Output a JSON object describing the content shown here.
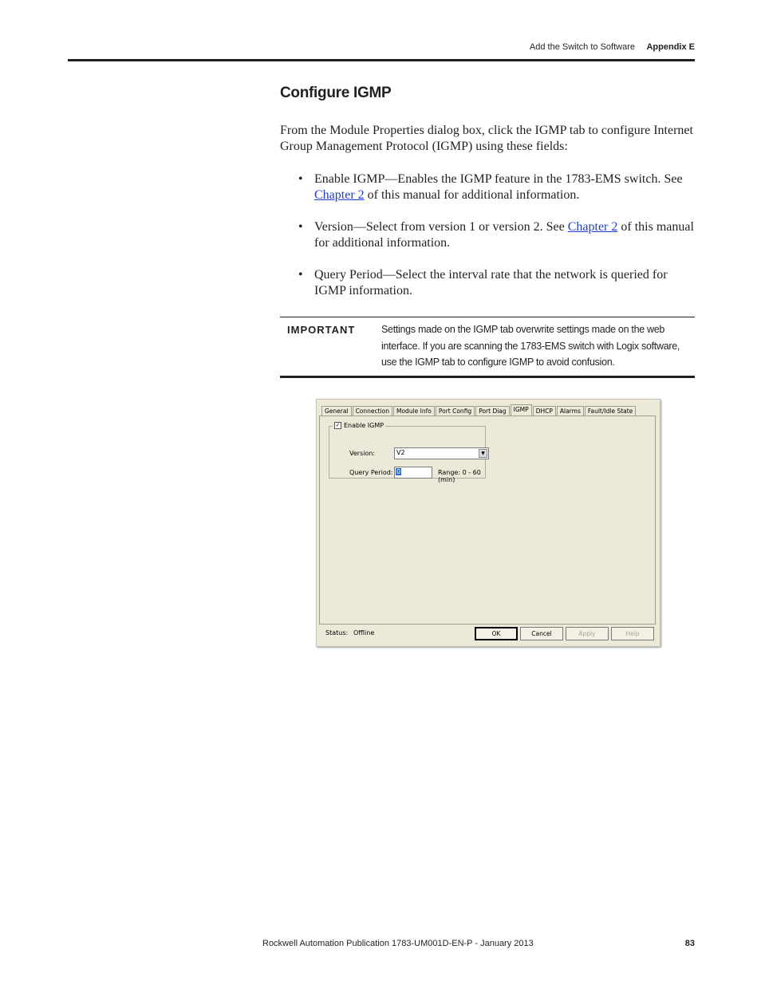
{
  "header": {
    "section": "Add the Switch to Software",
    "appendix": "Appendix E"
  },
  "title": "Configure IGMP",
  "intro": "From the Module Properties dialog box, click the IGMP tab to configure Internet Group Management Protocol (IGMP) using these fields:",
  "bullets": [
    {
      "text1": "Enable IGMP—Enables the IGMP feature in the 1783-EMS switch. See ",
      "link": "Chapter 2",
      "text2": " of this manual for additional information."
    },
    {
      "text1": "Version—Select from version 1 or version 2. See ",
      "link": "Chapter 2",
      "text2": " of this manual for additional information."
    },
    {
      "text1": "Query Period—Select the interval rate that the network is queried for IGMP information.",
      "link": "",
      "text2": ""
    }
  ],
  "important": {
    "label": "IMPORTANT",
    "text": "Settings made on the IGMP tab overwrite settings made on the web interface. If you are scanning the 1783-EMS switch with Logix software, use the IGMP tab to configure IGMP to avoid confusion."
  },
  "dialog": {
    "tabs": [
      "General",
      "Connection",
      "Module Info",
      "Port Config",
      "Port Diag",
      "IGMP",
      "DHCP",
      "Alarms",
      "Fault/Idle State"
    ],
    "enable_igmp_label": "Enable IGMP",
    "enable_igmp_checked": true,
    "check_mark": "✓",
    "version_label": "Version:",
    "version_value": "V2",
    "dropdown_glyph": "▼",
    "query_period_label": "Query Period:",
    "query_period_value": "0",
    "range_text": "Range: 0 - 60 (min)",
    "status_label": "Status:",
    "status_value": "Offline",
    "buttons": {
      "ok": "OK",
      "cancel": "Cancel",
      "apply": "Apply",
      "help": "Help"
    }
  },
  "footer": {
    "publication": "Rockwell Automation Publication 1783-UM001D-EN-P - January 2013",
    "page": "83"
  }
}
